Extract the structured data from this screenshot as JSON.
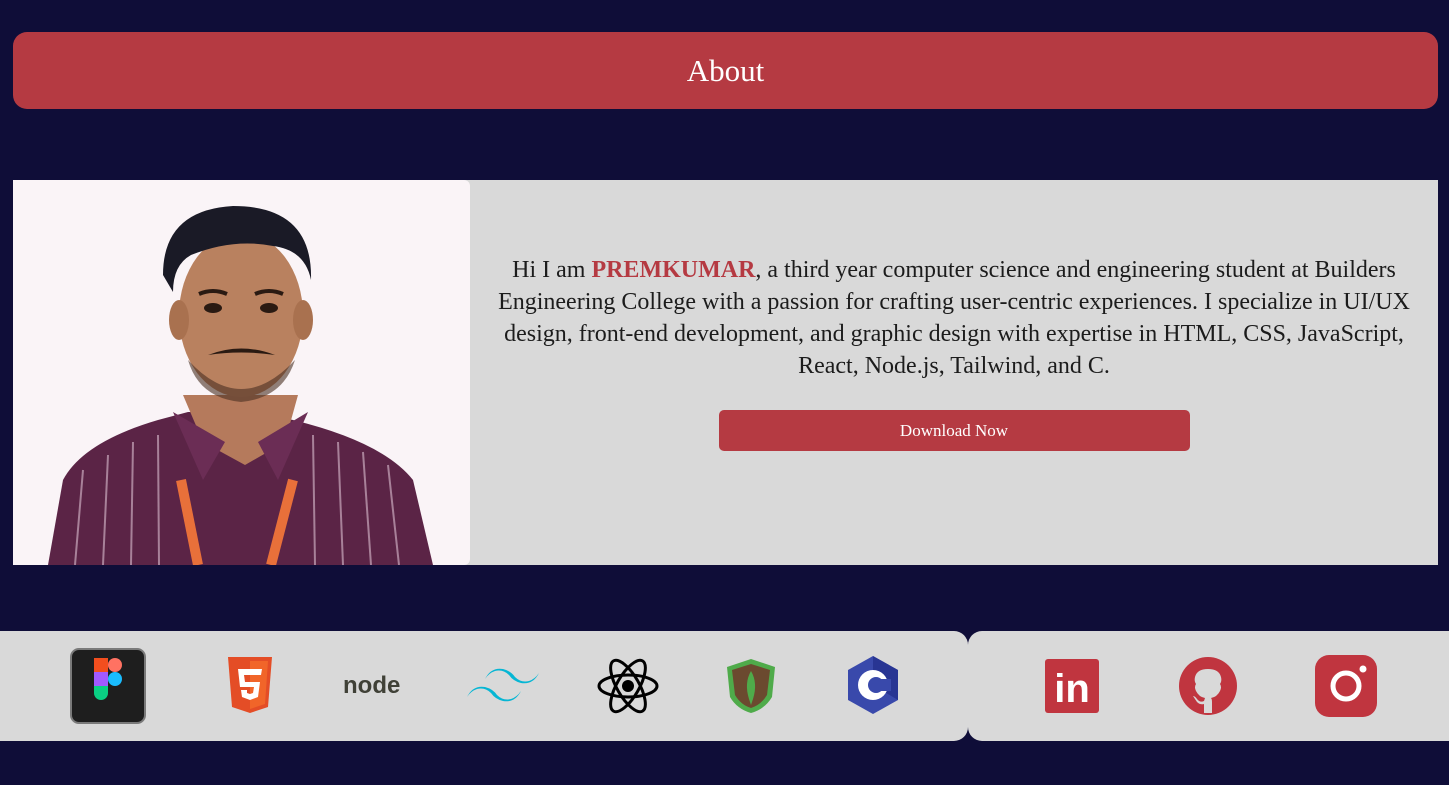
{
  "header": {
    "title": "About"
  },
  "profile": {
    "intro_prefix": "Hi I am ",
    "name": "PREMKUMAR",
    "intro_suffix": ", a third year computer science and engineering student at Builders Engineering College with a passion for crafting user-centric experiences. I specialize in UI/UX design, front-end development, and graphic design with expertise in HTML, CSS, JavaScript, React, Node.js, Tailwind, and C.",
    "download_label": "Download Now",
    "photo_icon": "profile-photo"
  },
  "skills": {
    "icons": [
      "figma-icon",
      "html5-icon",
      "nodejs-icon",
      "tailwind-icon",
      "react-icon",
      "mongodb-icon",
      "c-language-icon"
    ],
    "node_text": "node"
  },
  "social": {
    "icons": [
      "linkedin-icon",
      "github-icon",
      "instagram-icon"
    ],
    "linkedin_text": "in"
  },
  "colors": {
    "background": "#0f0d38",
    "accent": "#b53a42",
    "panel": "#d9d9d9",
    "photo_bg": "#faf4f7"
  }
}
